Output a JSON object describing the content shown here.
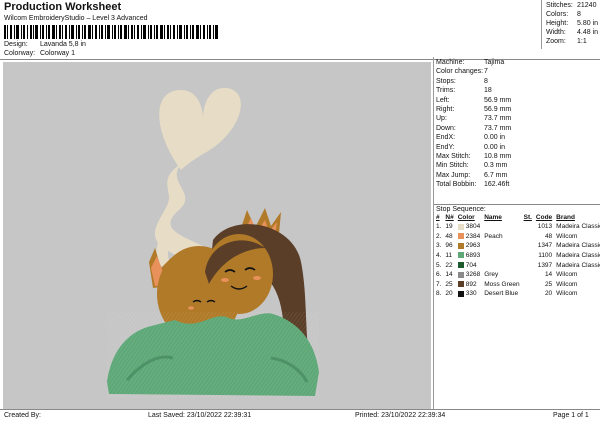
{
  "header": {
    "title": "Production Worksheet",
    "subtitle": "Wilcom EmbroideryStudio – Level 3 Advanced"
  },
  "meta": [
    {
      "label": "Design:",
      "value": "Lavanda 5,8 in"
    },
    {
      "label": "Colorway:",
      "value": "Colorway 1"
    }
  ],
  "stats": [
    {
      "label": "Stitches:",
      "value": "21240"
    },
    {
      "label": "Colors:",
      "value": "8"
    },
    {
      "label": "Height:",
      "value": "5.80 in"
    },
    {
      "label": "Width:",
      "value": "4.48 in"
    },
    {
      "label": "Zoom:",
      "value": "1:1"
    }
  ],
  "machine_info": [
    {
      "label": "Machine:",
      "value": "Tajima"
    },
    {
      "label": "Color changes:",
      "value": "7"
    },
    {
      "label": "Stops:",
      "value": "8"
    },
    {
      "label": "Trims:",
      "value": "18"
    },
    {
      "label": "Left:",
      "value": "56.9 mm"
    },
    {
      "label": "Right:",
      "value": "56.9 mm"
    },
    {
      "label": "Up:",
      "value": "73.7 mm"
    },
    {
      "label": "Down:",
      "value": "73.7 mm"
    },
    {
      "label": "EndX:",
      "value": "0.00 in"
    },
    {
      "label": "EndY:",
      "value": "0.00 in"
    },
    {
      "label": "Max Stitch:",
      "value": "10.8 mm"
    },
    {
      "label": "Min Stitch:",
      "value": "0.3 mm"
    },
    {
      "label": "Max Jump:",
      "value": "6.7 mm"
    },
    {
      "label": "Total Bobbin:",
      "value": "162.46ft"
    }
  ],
  "stop_sequence": {
    "title": "Stop Sequence:",
    "headers": [
      "#",
      "N#",
      "Color",
      "Name",
      "St.",
      "Code",
      "Brand"
    ],
    "rows": [
      {
        "num": "1.",
        "n": "19",
        "color": "#e7ddc6",
        "code_num": "3804",
        "name": "",
        "st": "",
        "code": "1013",
        "brand": "Madeira Classic 40"
      },
      {
        "num": "2.",
        "n": "48",
        "color": "#e8915b",
        "code_num": "2384",
        "name": "Peach",
        "st": "",
        "code": "48",
        "brand": "Wilcom"
      },
      {
        "num": "3.",
        "n": "96",
        "color": "#b07a28",
        "code_num": "2963",
        "name": "",
        "st": "",
        "code": "1347",
        "brand": "Madeira Classic 40"
      },
      {
        "num": "4.",
        "n": "11",
        "color": "#5ea878",
        "code_num": "6893",
        "name": "",
        "st": "",
        "code": "1100",
        "brand": "Madeira Classic 40"
      },
      {
        "num": "5.",
        "n": "22",
        "color": "#1c5a2e",
        "code_num": "704",
        "name": "",
        "st": "",
        "code": "1397",
        "brand": "Madeira Classic 40"
      },
      {
        "num": "6.",
        "n": "14",
        "color": "#8a8a8a",
        "code_num": "3268",
        "name": "Grey",
        "st": "",
        "code": "14",
        "brand": "Wilcom"
      },
      {
        "num": "7.",
        "n": "25",
        "color": "#5a3e28",
        "code_num": "892",
        "name": "Moss Green",
        "st": "",
        "code": "25",
        "brand": "Wilcom"
      },
      {
        "num": "8.",
        "n": "20",
        "color": "#111111",
        "code_num": "330",
        "name": "Desert Blue",
        "st": "",
        "code": "20",
        "brand": "Wilcom"
      }
    ]
  },
  "footer": {
    "created_by": "Created By:",
    "last_saved": "Last Saved: 23/10/2022 22:39:31",
    "printed": "Printed: 23/10/2022 22:39:34",
    "page": "Page 1 of 1"
  },
  "colors": {
    "background_panel": "#c6c6c6",
    "sweater": "#5ea878",
    "skin": "#b07a28",
    "hair": "#5a3e28",
    "steam": "#e7ddc6"
  }
}
